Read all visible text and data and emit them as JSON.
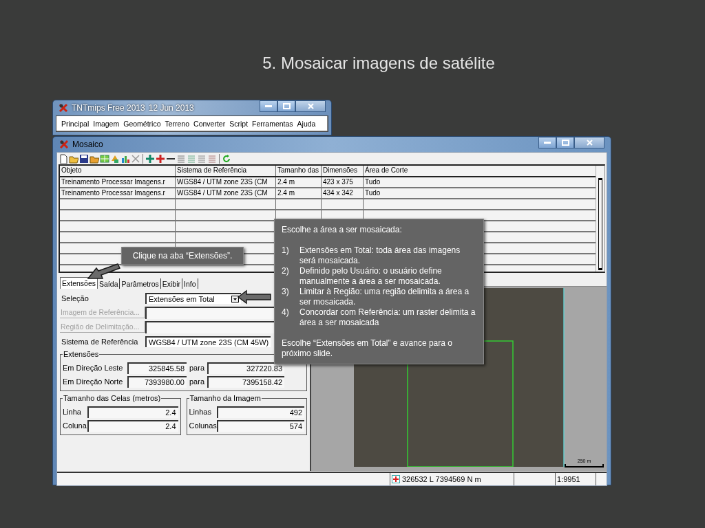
{
  "slide_title": "5. Mosaicar imagens de satélite",
  "main_window": {
    "title": "TNTmips Free 2013",
    "date": "12 Jun 2013",
    "menu": [
      "Principal",
      "Imagem",
      "Geométrico",
      "Terreno",
      "Converter",
      "Script",
      "Ferramentas",
      "Ajuda"
    ]
  },
  "mosaic": {
    "title": "Mosaico",
    "table": {
      "columns": [
        "Objeto",
        "Sistema de Referência",
        "Tamanho das",
        "Dimensões",
        "Área de Corte"
      ],
      "rows": [
        [
          "Treinamento Processar Imagens.r",
          "WGS84 / UTM zone 23S (CM",
          "2.4 m",
          "423 x 375",
          "Tudo"
        ],
        [
          "Treinamento Processar Imagens.r",
          "WGS84 / UTM zone 23S (CM",
          "2.4 m",
          "434 x 342",
          "Tudo"
        ]
      ]
    },
    "tabs": [
      {
        "label": "Extensões",
        "selected": true
      },
      {
        "label": "Saída",
        "selected": false
      },
      {
        "label": "Parâmetros",
        "selected": false
      },
      {
        "label": "Exibir",
        "selected": false
      },
      {
        "label": "Info",
        "selected": false
      }
    ],
    "form": [
      {
        "kind": "dropdown",
        "label": "Seleção",
        "value": "Extensões em Total"
      },
      {
        "kind": "button",
        "label": "Imagem de Referência...",
        "disabled": true
      },
      {
        "kind": "button",
        "label": "Região de Delimitação...",
        "disabled": true
      },
      {
        "kind": "dropdown",
        "label": "Sistema de Referência",
        "value": "WGS84 / UTM zone 23S (CM 45W)"
      }
    ],
    "extents": {
      "title": "Extensões",
      "rows": [
        {
          "label": "Em Direção Leste",
          "from": "325845.58",
          "to_label": "para",
          "to": "327220.83"
        },
        {
          "label": "Em Direção Norte",
          "from": "7393980.00",
          "to_label": "para",
          "to": "7395158.42"
        }
      ]
    },
    "cell_size": {
      "title": "Tamanho das Celas (metros)",
      "rows": [
        {
          "label": "Linha",
          "value": "2.4"
        },
        {
          "label": "Coluna",
          "value": "2.4"
        }
      ]
    },
    "image_size": {
      "title": "Tamanho da Imagem",
      "rows": [
        {
          "label": "Linhas",
          "value": "492"
        },
        {
          "label": "Colunas",
          "value": "574"
        }
      ]
    },
    "scale_bar": "250 m",
    "status": {
      "coordinates": "326532 L  7394569 N m",
      "scale": "1:9951"
    }
  },
  "callouts": [
    {
      "text": "Clique na aba “Extensões”."
    },
    {
      "intro": "Escolhe a área a ser mosaicada:",
      "items": [
        {
          "number": "1)",
          "text": "Extensões em Total: toda área das imagens será mosaicada."
        },
        {
          "number": "2)",
          "text": "Definido pelo Usuário: o usuário define manualmente a área a ser mosaicada."
        },
        {
          "number": "3)",
          "text": "Limitar à Região: uma região delimita a área a ser mosaicada."
        },
        {
          "number": "4)",
          "text": "Concordar com Referência: um raster delimita a área a ser mosaicada"
        }
      ],
      "outro": "Escolhe “Extensões em Total” e avance para o próximo slide."
    }
  ]
}
